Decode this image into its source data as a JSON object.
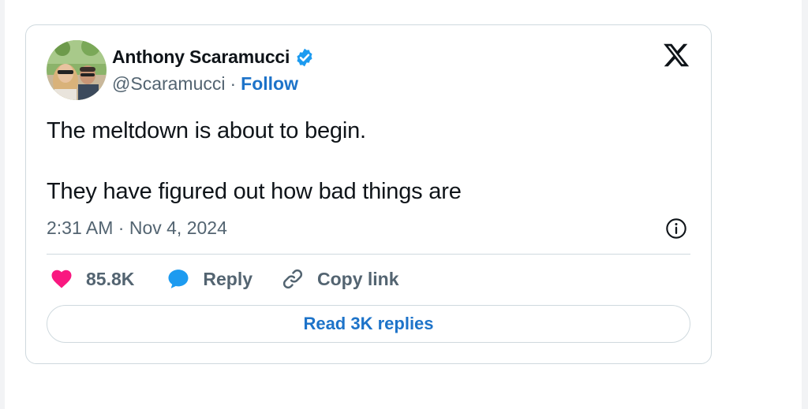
{
  "author": {
    "display_name": "Anthony Scaramucci",
    "handle": "@Scaramucci",
    "separator": "·",
    "follow_label": "Follow",
    "verified": true
  },
  "tweet": {
    "lines": [
      "The meltdown is about to begin.",
      "They have figured out how bad things are"
    ],
    "time": "2:31 AM",
    "date": "Nov 4, 2024",
    "meta_separator": "·"
  },
  "actions": {
    "likes": "85.8K",
    "reply_label": "Reply",
    "copy_label": "Copy link"
  },
  "footer": {
    "read_replies_label": "Read 3K replies"
  },
  "icons": {
    "verified": "verified-badge-icon",
    "platform": "x-logo-icon",
    "info": "info-icon",
    "like": "heart-icon",
    "reply": "speech-bubble-icon",
    "copy": "link-icon"
  },
  "colors": {
    "link_blue": "#1d73c9",
    "verified_blue": "#1d9bf0",
    "heart_pink": "#f91880",
    "text": "#0f1419",
    "secondary_text": "#536471",
    "border": "#cfd9de"
  }
}
